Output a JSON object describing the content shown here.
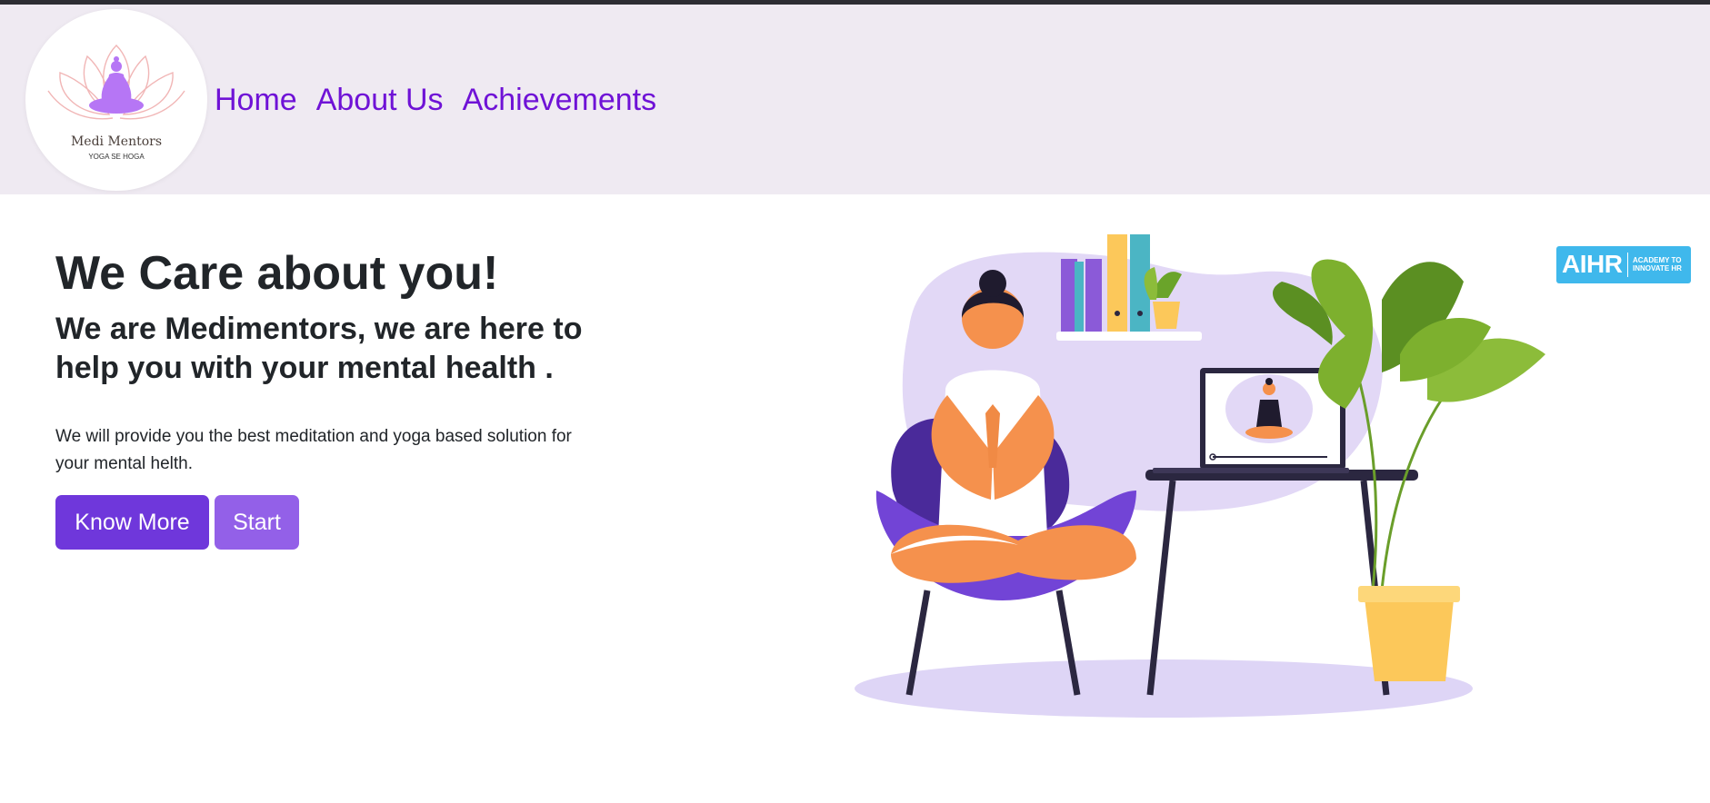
{
  "brand": {
    "name": "Medi Mentors",
    "tagline": "YOGA SE HOGA",
    "logo_icon": "meditating-person-lotus-icon"
  },
  "nav": {
    "items": [
      {
        "label": "Home"
      },
      {
        "label": "About Us"
      },
      {
        "label": "Achievements"
      }
    ]
  },
  "hero": {
    "title": "We Care about you!",
    "subtitle": "We are Medimentors, we are here to help you with your mental health .",
    "description": "We will provide you the best meditation and yoga based solution for your mental helth.",
    "buttons": {
      "know_more": "Know More",
      "start": "Start"
    }
  },
  "badge": {
    "main": "AIHR",
    "sub": "ACADEMY TO INNOVATE HR"
  },
  "colors": {
    "accent": "#6f12d6",
    "nav_bg": "#efeaf2",
    "primary_button": "#6f37db",
    "secondary_button": "#9360e8",
    "badge": "#3fb8ec"
  }
}
